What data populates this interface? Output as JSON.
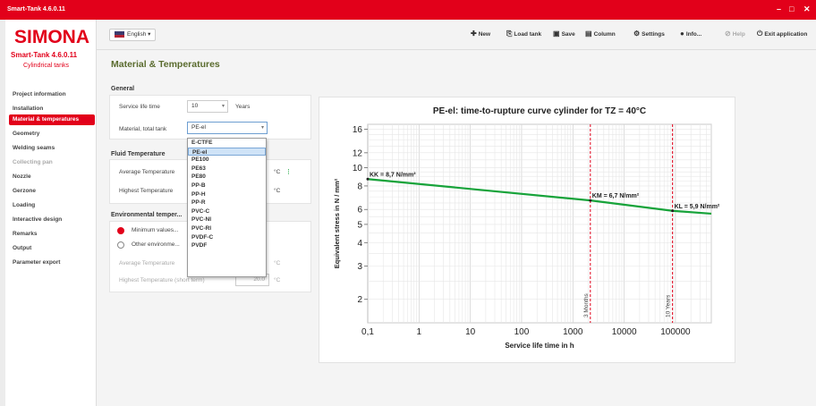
{
  "window": {
    "title": "Smart-Tank 4.6.0.11",
    "controls": [
      "–",
      "□",
      "✕"
    ]
  },
  "sidebar": {
    "logo": "SIMONA",
    "app_name": "Smart-Tank 4.6.0.11",
    "app_subtitle": "Cylindrical tanks",
    "items": [
      {
        "label": "Project information",
        "state": "normal"
      },
      {
        "label": "Installation",
        "state": "normal"
      },
      {
        "label": "Material & temperatures",
        "state": "active"
      },
      {
        "label": "Geometry",
        "state": "normal"
      },
      {
        "label": "Welding seams",
        "state": "normal"
      },
      {
        "label": "Collecting pan",
        "state": "disabled"
      },
      {
        "label": "Nozzle",
        "state": "normal"
      },
      {
        "label": "Gerzone",
        "state": "normal"
      },
      {
        "label": "Loading",
        "state": "normal"
      },
      {
        "label": "Interactive design",
        "state": "normal"
      },
      {
        "label": "Remarks",
        "state": "normal"
      },
      {
        "label": "Output",
        "state": "normal"
      },
      {
        "label": "Parameter export",
        "state": "normal"
      }
    ]
  },
  "toolbar": {
    "language": "English",
    "buttons": [
      {
        "icon": "plus-icon",
        "glyph": "✚",
        "label": "New",
        "enabled": true
      },
      {
        "icon": "open-tank-icon",
        "glyph": "⎘",
        "label": "Load tank",
        "enabled": true
      },
      {
        "icon": "save-icon",
        "glyph": "▣",
        "label": "Save",
        "enabled": true
      },
      {
        "icon": "column-icon",
        "glyph": "▤",
        "label": "Column",
        "enabled": true
      },
      {
        "icon": "gear-icon",
        "glyph": "⚙",
        "label": "Settings",
        "enabled": true
      },
      {
        "icon": "info-icon",
        "glyph": "●",
        "label": "Info...",
        "enabled": true
      },
      {
        "icon": "help-icon",
        "glyph": "⊘",
        "label": "Help",
        "enabled": false
      },
      {
        "icon": "power-icon",
        "glyph": "⏻",
        "label": "Exit application",
        "enabled": true
      }
    ]
  },
  "main": {
    "title": "Material & Temperatures",
    "general": {
      "heading": "General",
      "service_life_label": "Service life time",
      "service_life_value": "10",
      "service_life_unit": "Years",
      "material_label": "Material, total tank",
      "material_value": "PE-el"
    },
    "material_options": [
      "E-CTFE",
      "PE-el",
      "PE100",
      "PE63",
      "PE80",
      "PP-B",
      "PP-H",
      "PP-R",
      "PVC-C",
      "PVC-NI",
      "PVC-RI",
      "PVDF-C",
      "PVDF"
    ],
    "fluid_temperature": {
      "heading": "Fluid Temperature",
      "average_label": "Average Temperature",
      "highest_label": "Highest Temperature",
      "unit": "°C"
    },
    "environmental": {
      "heading": "Environmental temper...",
      "option_min": "Minimum values...",
      "option_other": "Other environme...",
      "average_label": "Average Temperature",
      "highest_label": "Highest Temperature (short term)",
      "highest_value": "20.0",
      "unit": "°C"
    }
  },
  "chart_data": {
    "type": "line",
    "title": "PE-el: time-to-rupture curve cylinder for TZ = 40°C",
    "xlabel": "Service life time in h",
    "ylabel": "Equivalent stress in N / mm²",
    "x_scale": "log",
    "y_scale": "log",
    "xlim": [
      0.1,
      500000
    ],
    "ylim": [
      1.5,
      17
    ],
    "x_ticks": [
      "0,1",
      "1",
      "10",
      "100",
      "1000",
      "10000",
      "100000"
    ],
    "y_ticks": [
      "2",
      "3",
      "4",
      "5",
      "6",
      "8",
      "10",
      "12",
      "16"
    ],
    "grid": true,
    "series": [
      {
        "color": "#17a33a",
        "x": [
          0.1,
          2190,
          87600,
          500000
        ],
        "y": [
          8.7,
          6.7,
          5.9,
          5.7
        ]
      }
    ],
    "vlines": [
      {
        "x": 2190,
        "label": "3 Months",
        "color": "#e2001a"
      },
      {
        "x": 87600,
        "label": "10 Years",
        "color": "#e2001a"
      }
    ],
    "annotations": [
      {
        "x": 0.1,
        "y": 8.7,
        "text": "KK = 8,7 N/mm²"
      },
      {
        "x": 2190,
        "y": 6.7,
        "text": "KM = 6,7 N/mm²"
      },
      {
        "x": 87600,
        "y": 5.9,
        "text": "KL = 5,9 N/mm²"
      }
    ]
  }
}
